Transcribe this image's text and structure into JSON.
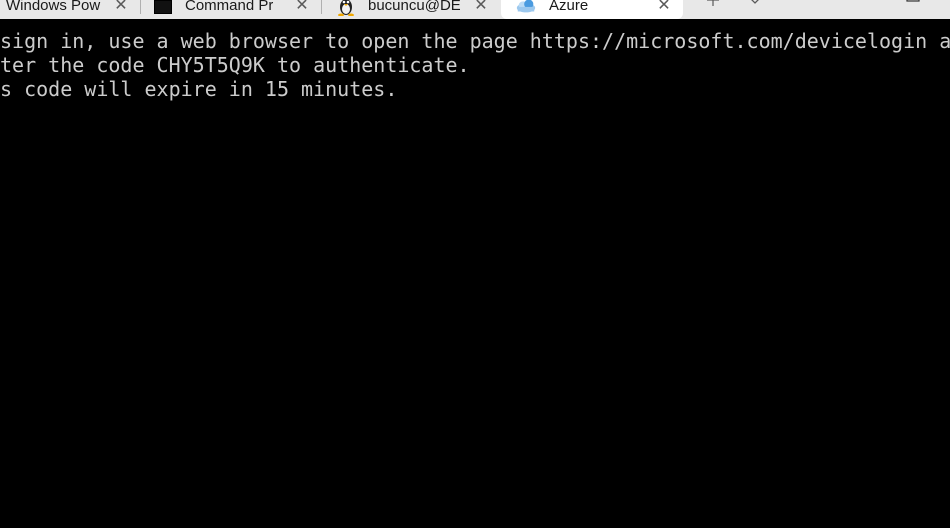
{
  "tabs": [
    {
      "title": "Windows Pow",
      "icon": "powershell-icon",
      "active": false
    },
    {
      "title": "Command Pr",
      "icon": "cmd-icon",
      "active": false
    },
    {
      "title": "bucuncu@DE",
      "icon": "linux-tux-icon",
      "active": false
    },
    {
      "title": "Azure",
      "icon": "azure-cloud-icon",
      "active": true
    }
  ],
  "terminal": {
    "lines": [
      "sign in, use a web browser to open the page https://microsoft.com/devicelogin an",
      "ter the code CHY5T5Q9K to authenticate.",
      "s code will expire in 15 minutes."
    ]
  },
  "colors": {
    "titlebar_bg": "#e8e8e8",
    "active_tab_bg": "#ffffff",
    "terminal_bg": "#000000",
    "terminal_fg": "#cccccc"
  }
}
